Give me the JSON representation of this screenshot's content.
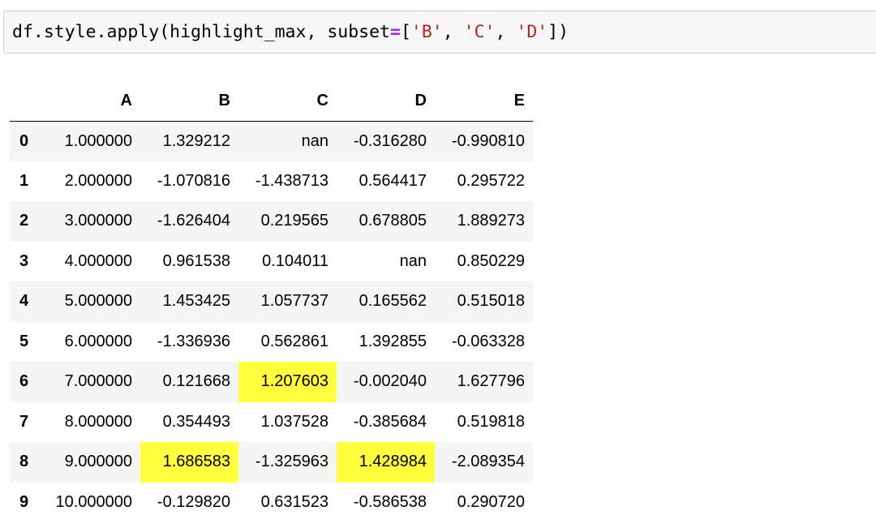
{
  "code_cell": {
    "tokens": [
      {
        "text": "df.style.apply",
        "kind": "fn"
      },
      {
        "text": "(",
        "kind": "paren"
      },
      {
        "text": "highlight_max, subset",
        "kind": "fn"
      },
      {
        "text": "=",
        "kind": "eq"
      },
      {
        "text": "[",
        "kind": "paren"
      },
      {
        "text": "'B'",
        "kind": "str"
      },
      {
        "text": ", ",
        "kind": "fn"
      },
      {
        "text": "'C'",
        "kind": "str"
      },
      {
        "text": ", ",
        "kind": "fn"
      },
      {
        "text": "'D'",
        "kind": "str"
      },
      {
        "text": "])",
        "kind": "paren"
      }
    ]
  },
  "colors": {
    "highlight": "#ffff3d",
    "string": "#ba2121",
    "operator": "#aa22ff",
    "stripe": "#f5f5f5"
  },
  "table": {
    "columns": [
      "A",
      "B",
      "C",
      "D",
      "E"
    ],
    "rows": [
      {
        "index": "0",
        "cells": [
          "1.000000",
          "1.329212",
          "nan",
          "-0.316280",
          "-0.990810"
        ],
        "highlight": []
      },
      {
        "index": "1",
        "cells": [
          "2.000000",
          "-1.070816",
          "-1.438713",
          "0.564417",
          "0.295722"
        ],
        "highlight": []
      },
      {
        "index": "2",
        "cells": [
          "3.000000",
          "-1.626404",
          "0.219565",
          "0.678805",
          "1.889273"
        ],
        "highlight": []
      },
      {
        "index": "3",
        "cells": [
          "4.000000",
          "0.961538",
          "0.104011",
          "nan",
          "0.850229"
        ],
        "highlight": []
      },
      {
        "index": "4",
        "cells": [
          "5.000000",
          "1.453425",
          "1.057737",
          "0.165562",
          "0.515018"
        ],
        "highlight": []
      },
      {
        "index": "5",
        "cells": [
          "6.000000",
          "-1.336936",
          "0.562861",
          "1.392855",
          "-0.063328"
        ],
        "highlight": []
      },
      {
        "index": "6",
        "cells": [
          "7.000000",
          "0.121668",
          "1.207603",
          "-0.002040",
          "1.627796"
        ],
        "highlight": [
          2
        ]
      },
      {
        "index": "7",
        "cells": [
          "8.000000",
          "0.354493",
          "1.037528",
          "-0.385684",
          "0.519818"
        ],
        "highlight": []
      },
      {
        "index": "8",
        "cells": [
          "9.000000",
          "1.686583",
          "-1.325963",
          "1.428984",
          "-2.089354"
        ],
        "highlight": [
          1,
          3
        ]
      },
      {
        "index": "9",
        "cells": [
          "10.000000",
          "-0.129820",
          "0.631523",
          "-0.586538",
          "0.290720"
        ],
        "highlight": []
      }
    ]
  }
}
